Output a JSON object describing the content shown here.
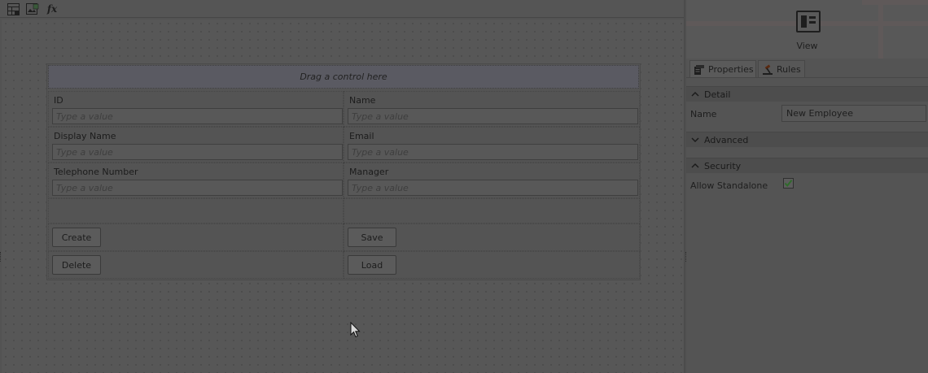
{
  "toolbar": {
    "icons": [
      "table-layout-icon",
      "add-image-icon",
      "function-icon"
    ],
    "fx_label": "fx"
  },
  "form": {
    "drop_hint": "Drag a control here",
    "placeholder": "Type a value",
    "fields": [
      {
        "label": "ID"
      },
      {
        "label": "Name"
      },
      {
        "label": "Display Name"
      },
      {
        "label": "Email"
      },
      {
        "label": "Telephone Number"
      },
      {
        "label": "Manager"
      }
    ],
    "buttons": {
      "create": "Create",
      "save": "Save",
      "delete": "Delete",
      "load": "Load"
    }
  },
  "panel": {
    "view_label": "View",
    "tabs": [
      {
        "label": "Properties",
        "icon": "properties-icon"
      },
      {
        "label": "Rules",
        "icon": "rules-icon"
      }
    ],
    "sections": {
      "detail": "Detail",
      "advanced": "Advanced",
      "security": "Security"
    },
    "properties": {
      "name_label": "Name",
      "name_value": "New Employee",
      "allow_standalone_label": "Allow Standalone",
      "allow_standalone_checked": true
    }
  },
  "colors": {
    "overlay_background": "#535353",
    "checkmark": "#2e6b2a"
  }
}
